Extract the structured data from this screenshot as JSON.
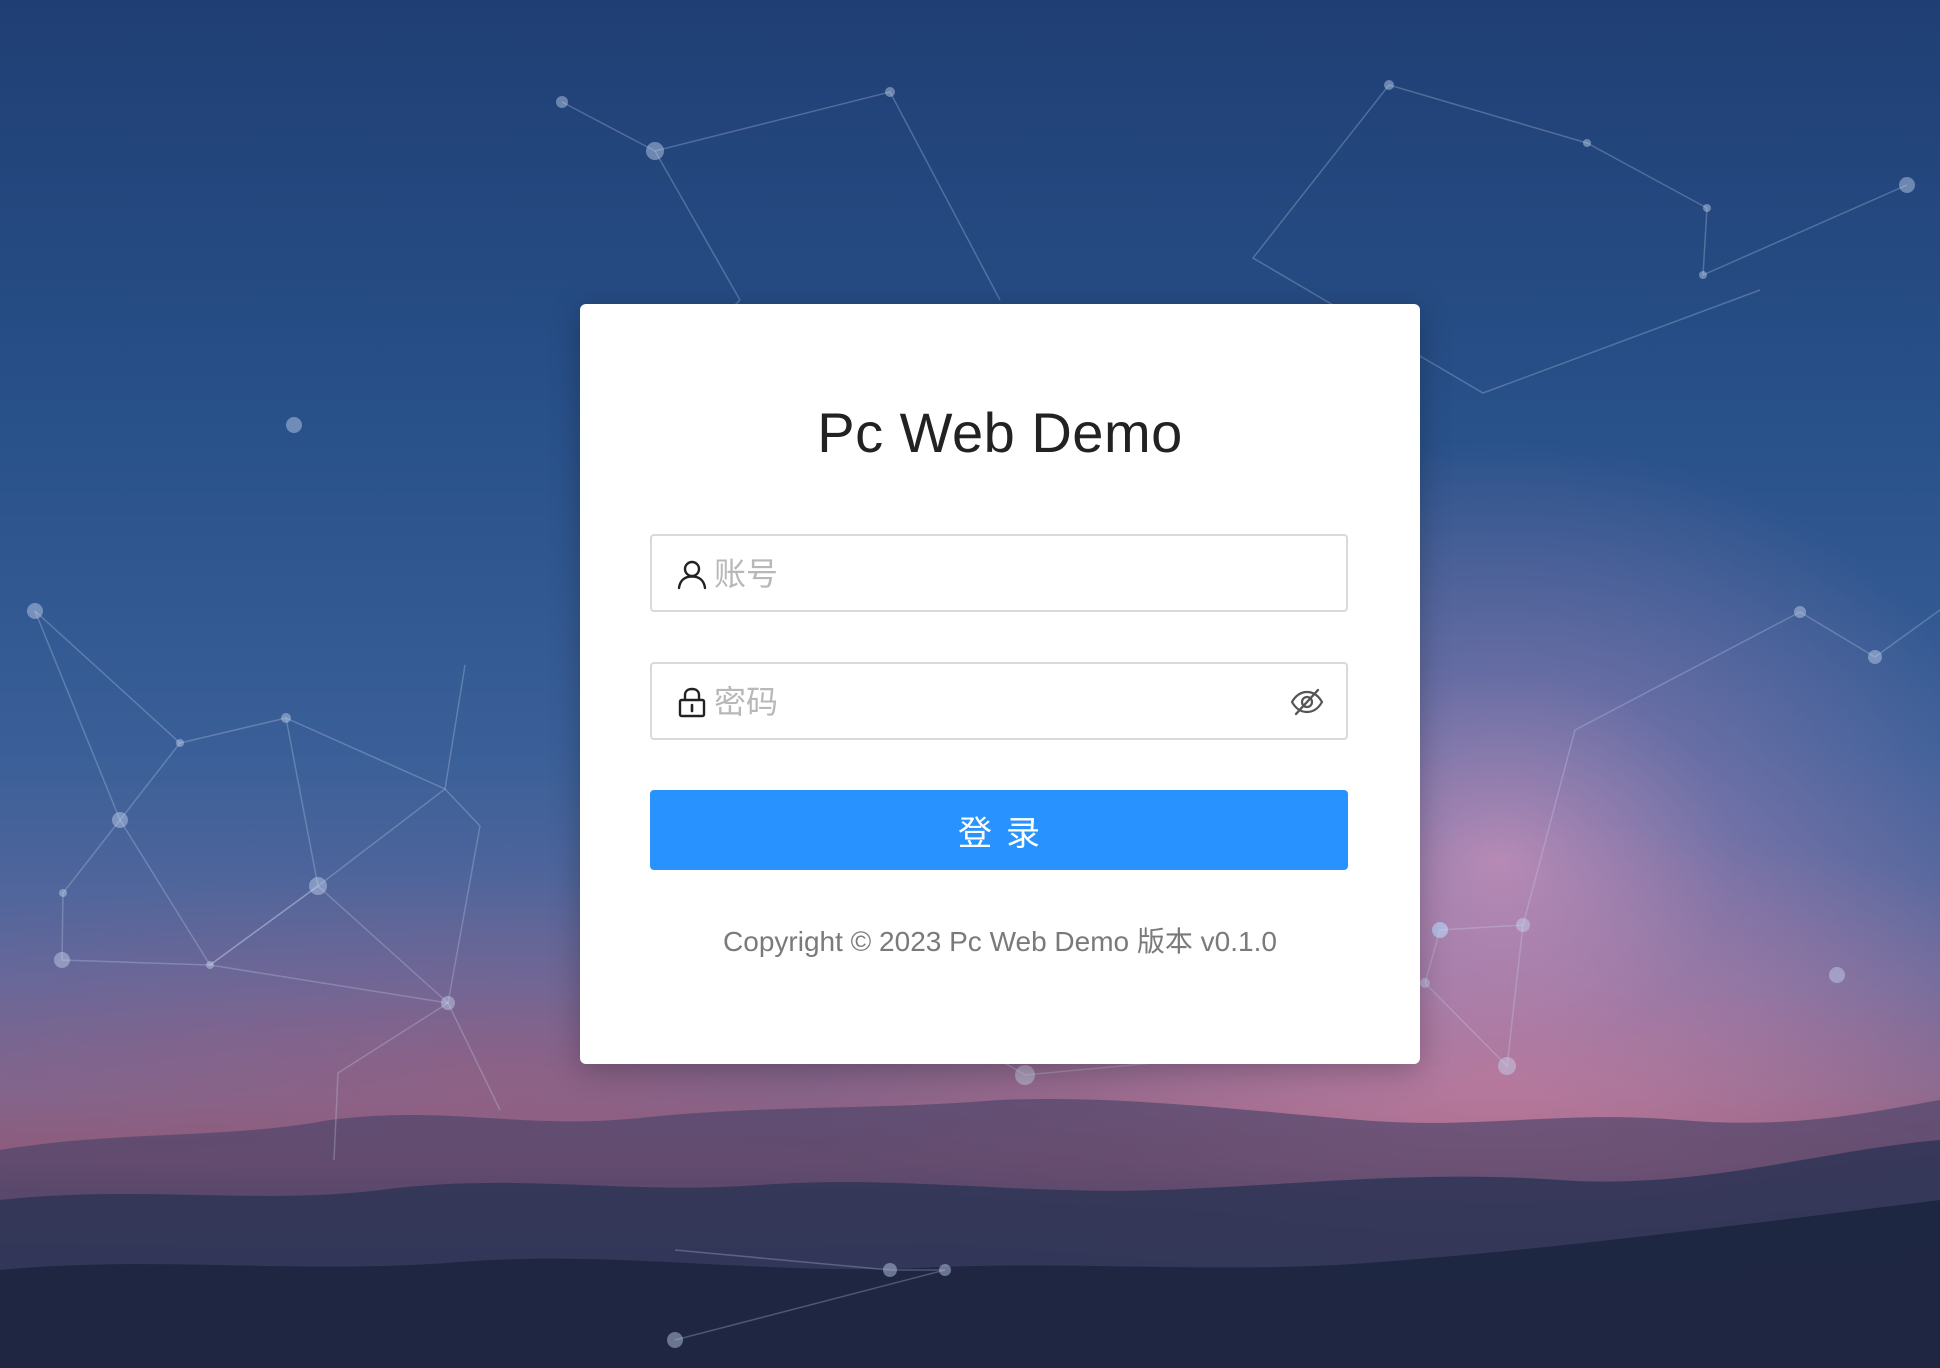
{
  "app": {
    "title": "Pc Web Demo"
  },
  "form": {
    "account_placeholder": "账号",
    "password_placeholder": "密码",
    "login_label": "登录"
  },
  "footer": {
    "copyright": "Copyright © 2023 Pc Web Demo 版本 v0.1.0"
  },
  "icons": {
    "account": "user-icon",
    "password": "lock-icon",
    "visibility": "eye-off-icon"
  },
  "colors": {
    "primary": "#2893fe",
    "card": "#ffffff",
    "placeholder": "#b8b8b8"
  }
}
